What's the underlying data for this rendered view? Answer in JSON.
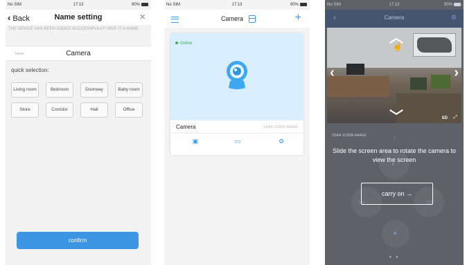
{
  "status_bar": {
    "carrier": "No SIM",
    "time": "17:13",
    "battery": "90%"
  },
  "name_setting": {
    "back_label": "Back",
    "title": "Name setting",
    "notice": "THE DEVICE HAS BEEN ADDED SUCCESSFULLY! GIVE IT A NAME",
    "name_label": "name",
    "name_value": "Camera",
    "quick_selection_label": "quick selection:",
    "rooms": [
      "Living room",
      "Bedroom",
      "Doorway",
      "Baby room",
      "Store",
      "Corridor",
      "Hall",
      "Office"
    ],
    "confirm_label": "confirm"
  },
  "device_list": {
    "title": "Camera",
    "status": "Online",
    "device_name": "Camera",
    "device_serial": "SSAA-112606-AAAEE"
  },
  "tutorial": {
    "title": "Camera",
    "serial": "SSAA-112606-AAAEE",
    "hint": "Slide the screen area to rotate the camera to view the screen",
    "carry_on_label": "carry on →",
    "quality": "SD"
  },
  "colors": {
    "accent": "#3d96e5",
    "online": "#35b24a",
    "overlay": "#5e6168"
  }
}
